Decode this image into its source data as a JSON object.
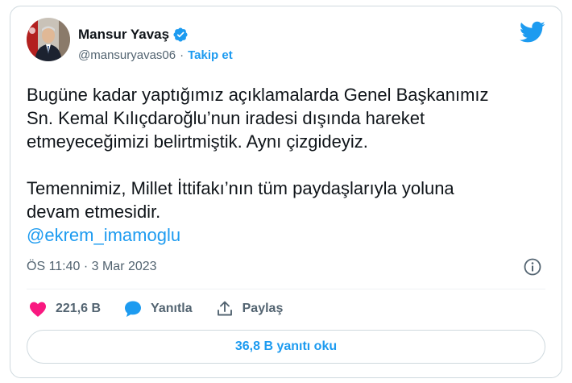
{
  "author": {
    "name": "Mansur Yavaş",
    "handle": "@mansuryavas06",
    "separator": "·",
    "follow_label": "Takip et",
    "verified": true
  },
  "icons": {
    "brand": "twitter-bird-icon",
    "verified": "verified-badge-icon",
    "info": "info-icon",
    "like": "heart-icon",
    "reply": "speech-bubble-icon",
    "share": "share-upload-icon"
  },
  "colors": {
    "accent": "#1d9bf0",
    "like": "#f91880",
    "text": "#0f1419",
    "muted": "#536471",
    "border": "#cfd9de"
  },
  "tweet": {
    "lines": [
      "Bugüne kadar yaptığımız açıklamalarda Genel Başkanımız",
      "Sn. Kemal Kılıçdaroğlu’nun iradesi dışında hareket",
      "etmeyeceğimizi belirtmiştik. Aynı çizgideyiz.",
      "Temennimiz, Millet İttifakı’nın tüm paydaşlarıyla yoluna",
      "devam etmesidir."
    ],
    "mention": "@ekrem_imamoglu",
    "timestamp": "ÖS 11:40 · 3 Mar 2023"
  },
  "actions": {
    "likes": "221,6 B",
    "reply_label": "Yanıtla",
    "share_label": "Paylaş"
  },
  "replies_button": "36,8 B yanıtı oku"
}
